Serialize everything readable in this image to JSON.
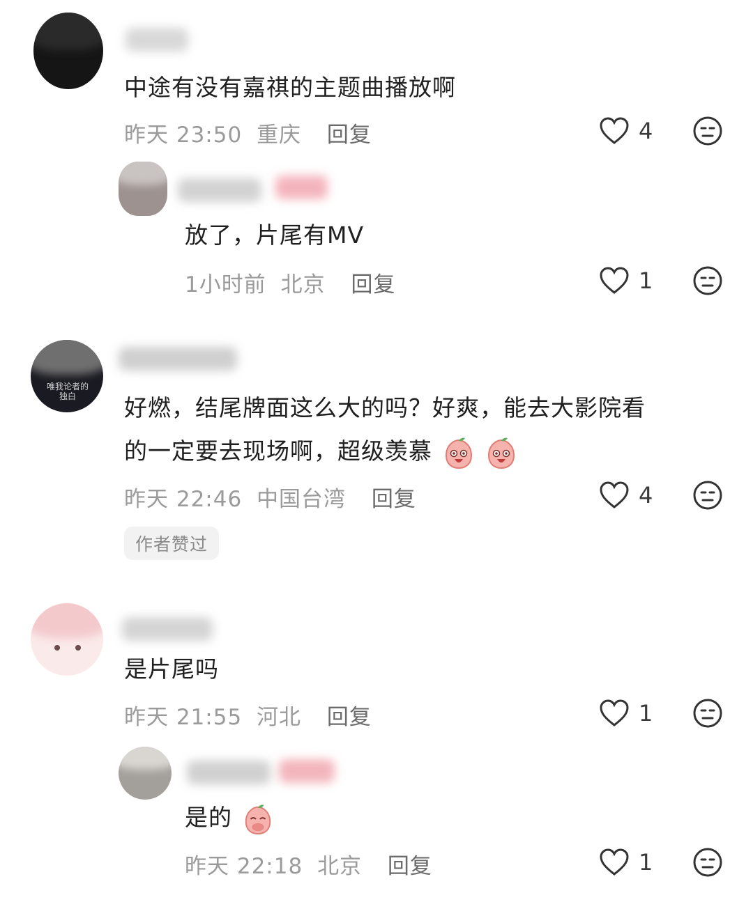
{
  "comments": [
    {
      "text": "中途有没有嘉祺的主题曲播放啊",
      "time": "昨天 23:50",
      "location": "重庆",
      "reply_label": "回复",
      "likes": "4",
      "reply": {
        "text": "放了，片尾有MV",
        "time": "1小时前",
        "location": "北京",
        "reply_label": "回复",
        "likes": "1"
      }
    },
    {
      "text_line1": "好燃，结尾牌面这么大的吗？好爽，能去大影院看",
      "text_line2": "的一定要去现场啊，超级羡慕",
      "time": "昨天 22:46",
      "location": "中国台湾",
      "reply_label": "回复",
      "likes": "4",
      "author_liked": "作者赞过",
      "avatar_caption": "唯我论者的独白"
    },
    {
      "text": "是片尾吗",
      "time": "昨天 21:55",
      "location": "河北",
      "reply_label": "回复",
      "likes": "1",
      "reply": {
        "text": "是的",
        "time": "昨天 22:18",
        "location": "北京",
        "reply_label": "回复",
        "likes": "1"
      }
    }
  ],
  "icons": {
    "like": "heart-outline-icon",
    "dislike": "neutral-face-icon",
    "emoji": "peach-face-emoji"
  }
}
